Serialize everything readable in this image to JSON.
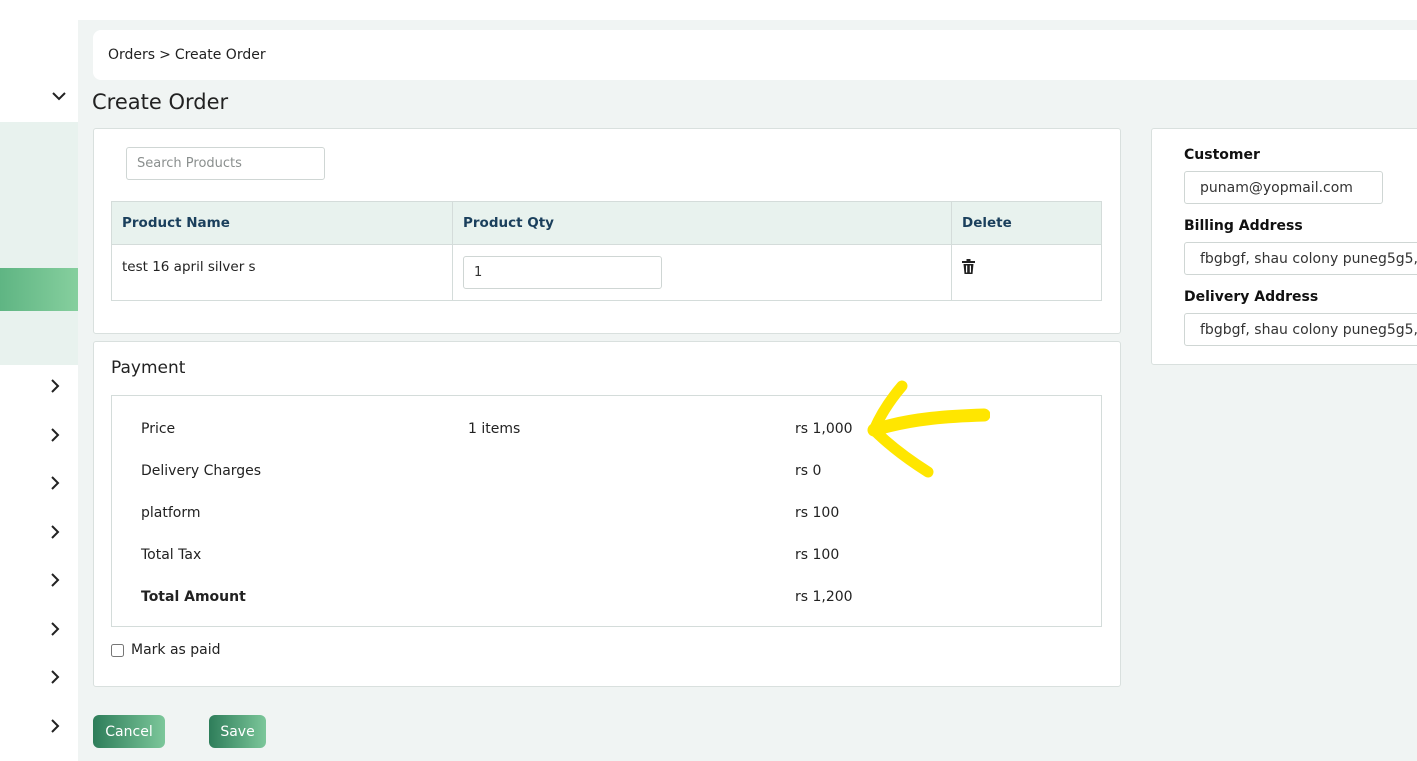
{
  "breadcrumb": {
    "root": "Orders",
    "separator": ">",
    "current": "Create Order"
  },
  "page": {
    "title": "Create Order"
  },
  "products": {
    "search_placeholder": "Search Products",
    "columns": [
      "Product Name",
      "Product Qty",
      "Delete"
    ],
    "rows": [
      {
        "name": "test 16 april silver s",
        "qty": "1"
      }
    ]
  },
  "payment": {
    "title": "Payment",
    "rows": [
      {
        "label": "Price",
        "detail": "1 items",
        "amount": "rs 1,000"
      },
      {
        "label": "Delivery Charges",
        "detail": "",
        "amount": "rs 0"
      },
      {
        "label": "platform",
        "detail": "",
        "amount": "rs 100"
      },
      {
        "label": "Total Tax",
        "detail": "",
        "amount": "rs 100"
      },
      {
        "label": "Total Amount",
        "detail": "",
        "amount": "rs 1,200"
      }
    ],
    "mark_paid_label": "Mark as paid",
    "mark_paid_checked": false
  },
  "actions": {
    "cancel_label": "Cancel",
    "save_label": "Save"
  },
  "customer": {
    "customer_label": "Customer",
    "customer_value": "punam@yopmail.com",
    "billing_label": "Billing Address",
    "billing_value": "fbgbgf, shau colony puneg5g5,",
    "delivery_label": "Delivery Address",
    "delivery_value": "fbgbgf, shau colony puneg5g5,"
  },
  "sidebar": {
    "icons": [
      "chevron-down-icon",
      "chevron-right-icon"
    ],
    "active_color": "#6cbf8c"
  },
  "colors": {
    "accent": "#2e7d5a",
    "table_header_bg": "#e8f2ee",
    "annotation": "#ffe600"
  }
}
